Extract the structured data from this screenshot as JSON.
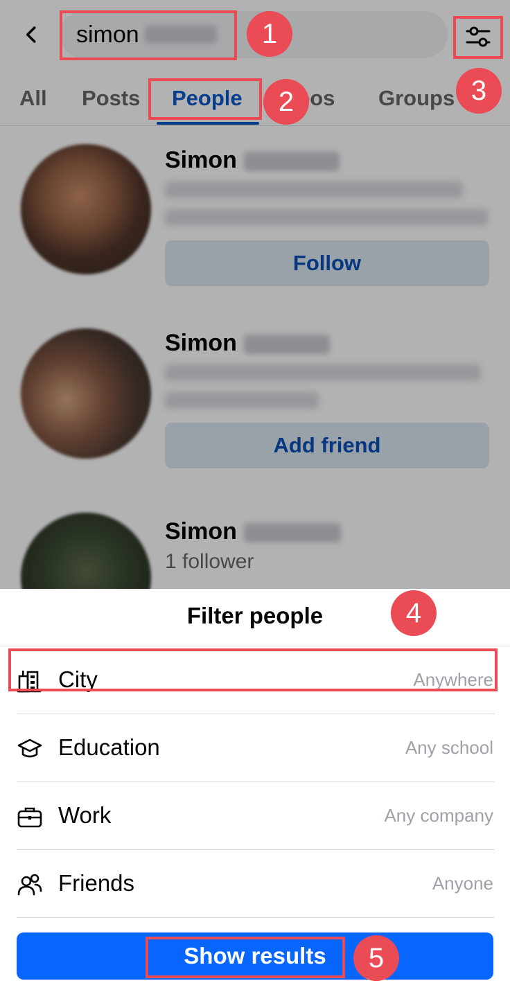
{
  "search": {
    "query": "simon"
  },
  "tabs": [
    {
      "label": "All"
    },
    {
      "label": "Posts"
    },
    {
      "label": "People"
    },
    {
      "label": "eos"
    },
    {
      "label": "Groups"
    }
  ],
  "results": [
    {
      "name": "Simon",
      "action_label": "Follow"
    },
    {
      "name": "Simon",
      "action_label": "Add friend"
    },
    {
      "name": "Simon",
      "subtitle": "1 follower"
    }
  ],
  "filter_sheet": {
    "title": "Filter people",
    "rows": [
      {
        "label": "City",
        "value": "Anywhere",
        "icon": "city-icon"
      },
      {
        "label": "Education",
        "value": "Any school",
        "icon": "graduation-cap-icon"
      },
      {
        "label": "Work",
        "value": "Any company",
        "icon": "briefcase-icon"
      },
      {
        "label": "Friends",
        "value": "Anyone",
        "icon": "friends-icon"
      }
    ],
    "show_results_label": "Show results"
  },
  "callouts": [
    "1",
    "2",
    "3",
    "4",
    "5"
  ],
  "colors": {
    "accent": "#0866ff",
    "tab_active": "#0a58ca",
    "callout": "#ea4b54",
    "muted_text": "#65676b"
  }
}
